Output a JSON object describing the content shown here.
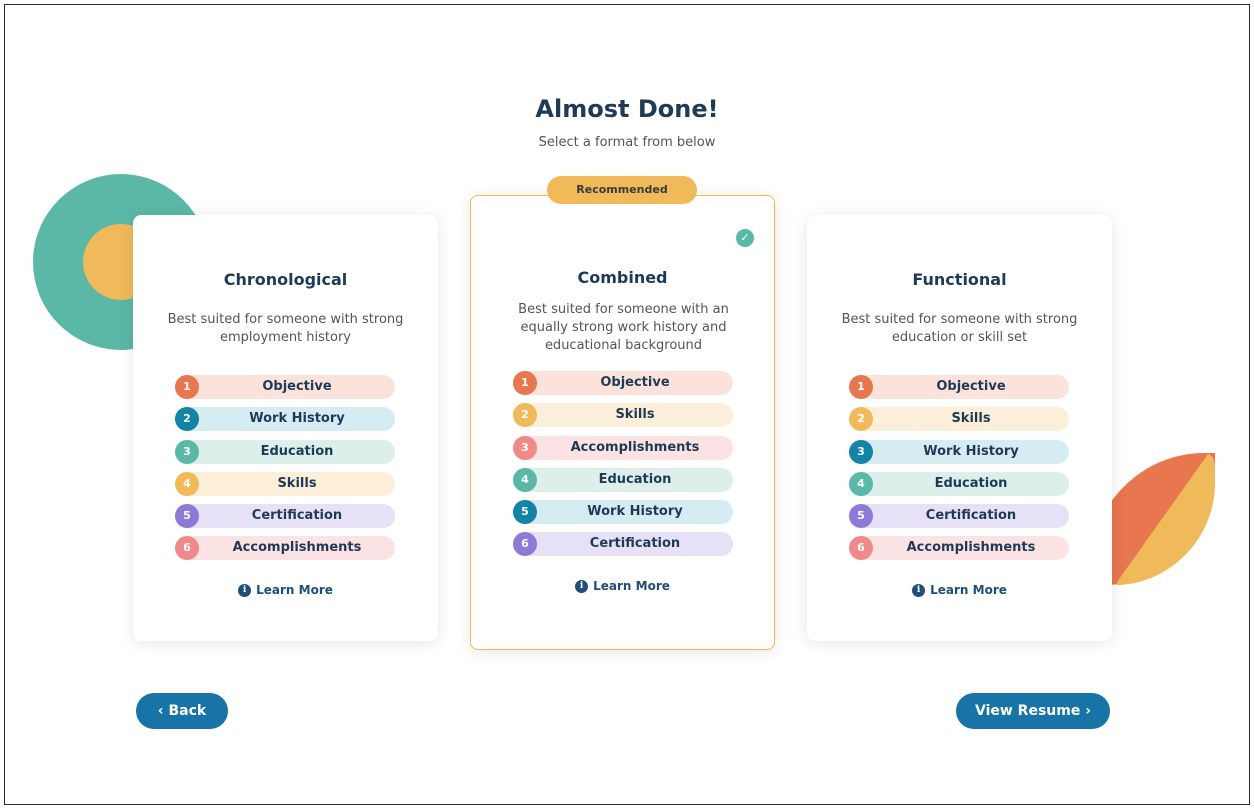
{
  "header": {
    "title": "Almost Done!",
    "subtitle": "Select a format from below"
  },
  "cards": [
    {
      "title": "Chronological",
      "description": "Best suited for someone with strong employment history",
      "learn_more": "Learn More",
      "sections": [
        {
          "num": "1",
          "label": "Objective",
          "color": "#e8764f",
          "bg": "#fbe3dc"
        },
        {
          "num": "2",
          "label": "Work History",
          "color": "#1383a6",
          "bg": "#d6ecf3"
        },
        {
          "num": "3",
          "label": "Education",
          "color": "#5bb8a6",
          "bg": "#dcefeb"
        },
        {
          "num": "4",
          "label": "Skills",
          "color": "#f0b95a",
          "bg": "#fcefd9"
        },
        {
          "num": "5",
          "label": "Certification",
          "color": "#8c7ad6",
          "bg": "#e6e1f6"
        },
        {
          "num": "6",
          "label": "Accomplishments",
          "color": "#f08a8a",
          "bg": "#fce3e3"
        }
      ]
    },
    {
      "title": "Combined",
      "description": "Best suited for someone with an equally strong work history and educational background",
      "learn_more": "Learn More",
      "badge": "Recommended",
      "selected": true,
      "sections": [
        {
          "num": "1",
          "label": "Objective",
          "color": "#e8764f",
          "bg": "#fbe3dc"
        },
        {
          "num": "2",
          "label": "Skills",
          "color": "#f0b95a",
          "bg": "#fcefd9"
        },
        {
          "num": "3",
          "label": "Accomplishments",
          "color": "#f08a8a",
          "bg": "#fce3e3"
        },
        {
          "num": "4",
          "label": "Education",
          "color": "#5bb8a6",
          "bg": "#dcefeb"
        },
        {
          "num": "5",
          "label": "Work History",
          "color": "#1383a6",
          "bg": "#d6ecf3"
        },
        {
          "num": "6",
          "label": "Certification",
          "color": "#8c7ad6",
          "bg": "#e6e1f6"
        }
      ]
    },
    {
      "title": "Functional",
      "description": "Best suited for someone with strong education or skill set",
      "learn_more": "Learn More",
      "sections": [
        {
          "num": "1",
          "label": "Objective",
          "color": "#e8764f",
          "bg": "#fbe3dc"
        },
        {
          "num": "2",
          "label": "Skills",
          "color": "#f0b95a",
          "bg": "#fcefd9"
        },
        {
          "num": "3",
          "label": "Work History",
          "color": "#1383a6",
          "bg": "#d6ecf3"
        },
        {
          "num": "4",
          "label": "Education",
          "color": "#5bb8a6",
          "bg": "#dcefeb"
        },
        {
          "num": "5",
          "label": "Certification",
          "color": "#8c7ad6",
          "bg": "#e6e1f6"
        },
        {
          "num": "6",
          "label": "Accomplishments",
          "color": "#f08a8a",
          "bg": "#fce3e3"
        }
      ]
    }
  ],
  "buttons": {
    "back": "Back",
    "view_resume": "View Resume",
    "back_icon": "chevron-left-icon",
    "view_icon": "chevron-right-icon"
  },
  "colors": {
    "primary": "#1873a6",
    "accent": "#f0b95a",
    "teal": "#5bb8a6",
    "orange": "#e8764f"
  }
}
